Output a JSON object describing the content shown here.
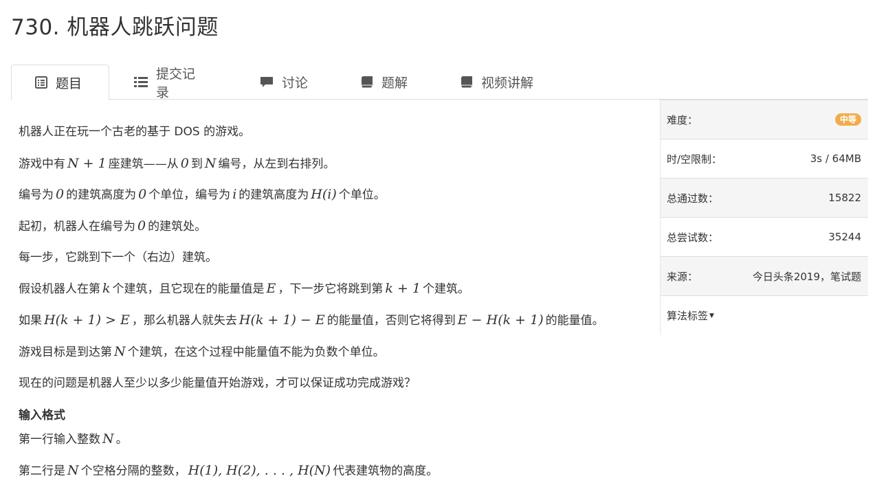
{
  "problem": {
    "title": "730. 机器人跳跃问题"
  },
  "tabs": [
    {
      "label": "题目",
      "icon": "list-alt-icon"
    },
    {
      "label": "提交记录",
      "icon": "list-icon"
    },
    {
      "label": "讨论",
      "icon": "comment-icon"
    },
    {
      "label": "题解",
      "icon": "book-icon"
    },
    {
      "label": "视频讲解",
      "icon": "book-icon"
    }
  ],
  "statement": {
    "p1": "机器人正在玩一个古老的基于 DOS 的游戏。",
    "p2a": "游戏中有",
    "p2m1": "N + 1",
    "p2b": "座建筑——从",
    "p2m2": "0",
    "p2c": "到",
    "p2m3": "N",
    "p2d": "编号，从左到右排列。",
    "p3a": "编号为",
    "p3m1": "0",
    "p3b": "的建筑高度为",
    "p3m2": "0",
    "p3c": "个单位，编号为",
    "p3m3": "i",
    "p3d": "的建筑高度为",
    "p3m4": "H(i)",
    "p3e": "个单位。",
    "p4a": "起初，机器人在编号为",
    "p4m1": "0",
    "p4b": "的建筑处。",
    "p5": "每一步，它跳到下一个（右边）建筑。",
    "p6a": "假设机器人在第",
    "p6m1": "k",
    "p6b": "个建筑，且它现在的能量值是",
    "p6m2": "E",
    "p6c": "，下一步它将跳到第",
    "p6m3": "k + 1",
    "p6d": "个建筑。",
    "p7a": "如果",
    "p7m1": "H(k + 1) > E",
    "p7b": "，那么机器人就失去",
    "p7m2": "H(k + 1) − E",
    "p7c": "的能量值，否则它将得到",
    "p7m3": "E − H(k + 1)",
    "p7d": "的能量值。",
    "p8a": "游戏目标是到达第",
    "p8m1": "N",
    "p8b": "个建筑，在这个过程中能量值不能为负数个单位。",
    "p9": "现在的问题是机器人至少以多少能量值开始游戏，才可以保证成功完成游戏？",
    "input_heading": "输入格式",
    "p10a": "第一行输入整数",
    "p10m1": "N",
    "p10b": "。",
    "p11a": "第二行是",
    "p11m1": "N",
    "p11b": "个空格分隔的整数，",
    "p11m2": "H(1), H(2), . . . , H(N)",
    "p11c": "代表建筑物的高度。"
  },
  "sidebar": {
    "difficulty_label": "难度：",
    "difficulty_value": "中等",
    "difficulty_color": "#f0ad4e",
    "limit_label": "时/空限制：",
    "limit_value": "3s / 64MB",
    "passed_label": "总通过数：",
    "passed_value": "15822",
    "attempts_label": "总尝试数：",
    "attempts_value": "35244",
    "source_label": "来源：",
    "source_value": "今日头条2019，笔试题",
    "tags_label": "算法标签"
  }
}
